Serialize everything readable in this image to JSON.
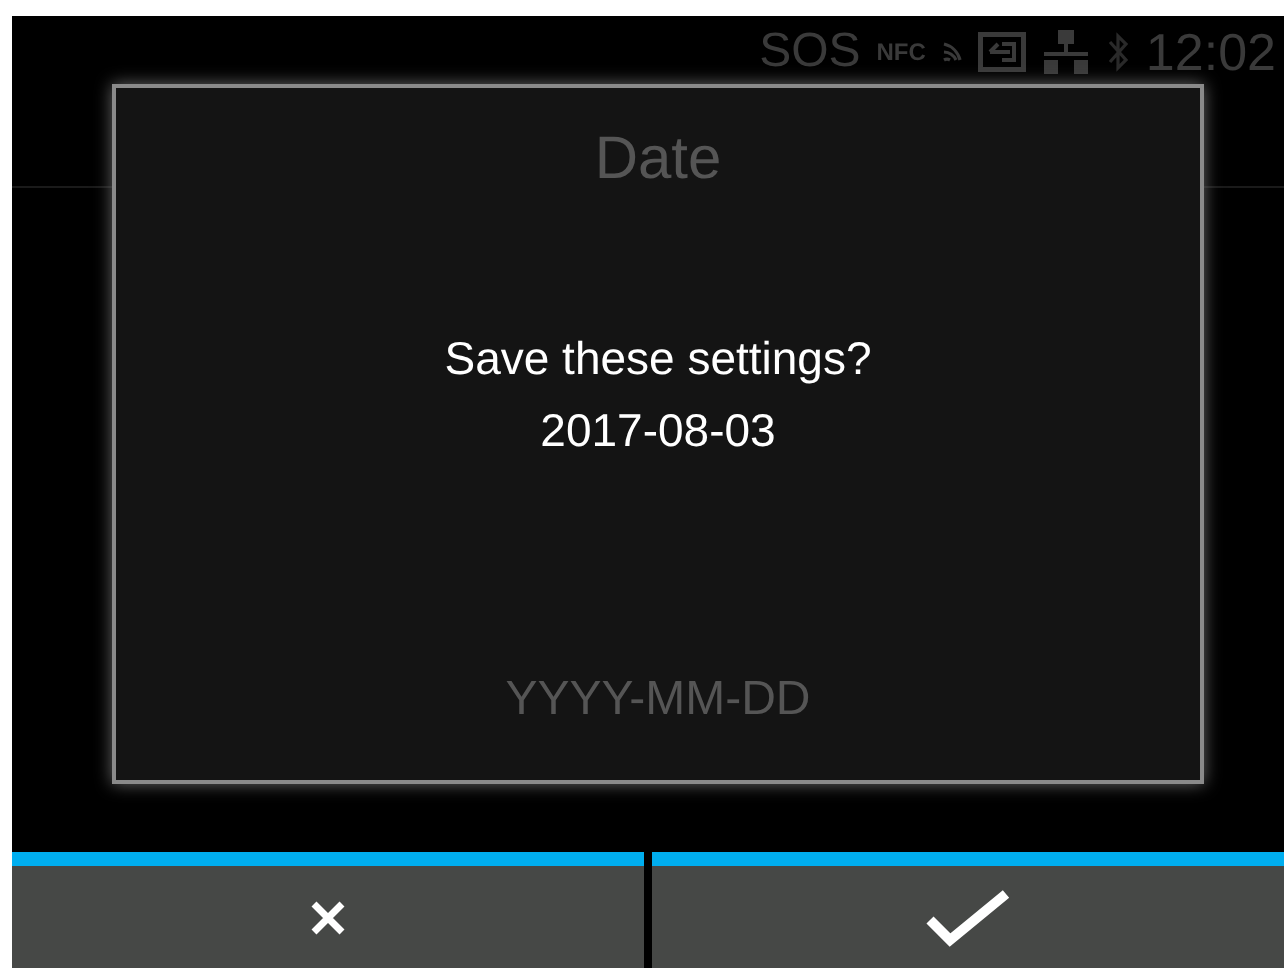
{
  "status_bar": {
    "sos": "SOS",
    "nfc": "NFC",
    "time": "12:02"
  },
  "background": {
    "title": "Date",
    "format_hint": "YYYY-MM-DD"
  },
  "dialog": {
    "message": "Save these settings?",
    "value": "2017-08-03"
  },
  "buttons": [
    {
      "kind": "cancel"
    },
    {
      "kind": "confirm"
    }
  ]
}
